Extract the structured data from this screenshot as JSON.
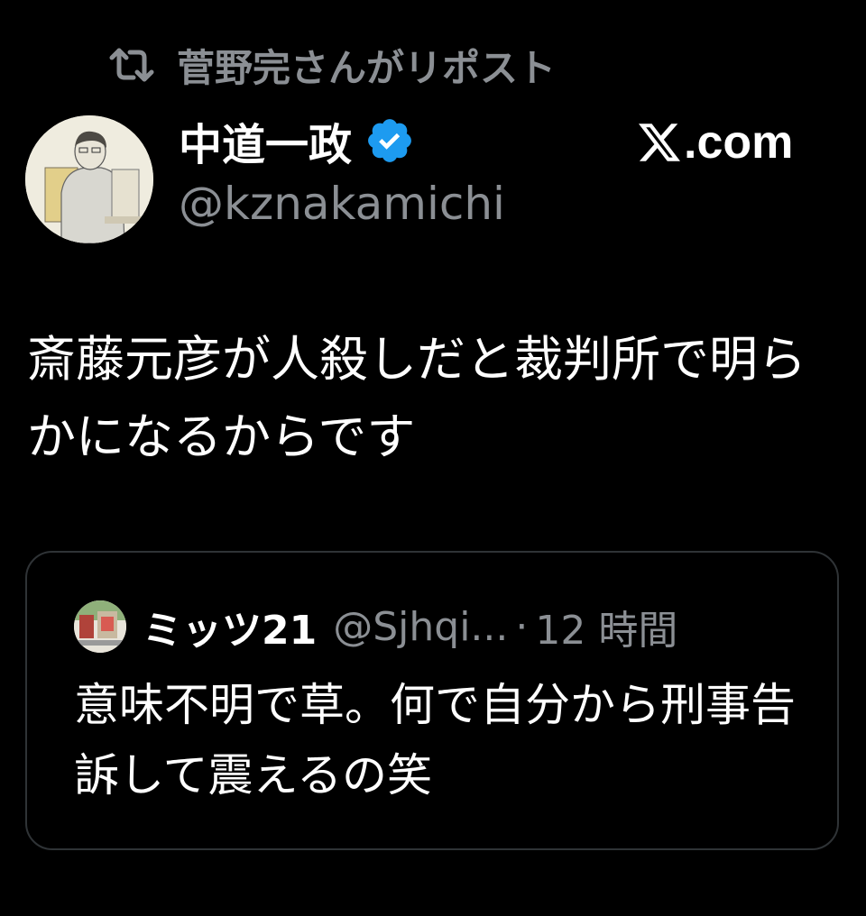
{
  "repost": {
    "icon": "repost-icon",
    "label": "菅野完さんがリポスト"
  },
  "author": {
    "display_name": "中道一政",
    "handle": "@kznakamichi",
    "verified": true,
    "verified_color": "#1d9bf0"
  },
  "source": {
    "label": ".com",
    "icon": "x-logo-icon"
  },
  "tweet": {
    "text": "斎藤元彦が人殺しだと裁判所で明らかになるからです"
  },
  "quote": {
    "display_name": "ミッツ21",
    "handle": "@Sjhqi...",
    "separator": "·",
    "time": "12 時間",
    "text": "意味不明で草。何で自分から刑事告訴して震えるの笑"
  },
  "colors": {
    "background": "#000000",
    "text_primary": "#ffffff",
    "text_secondary": "#8b8f94",
    "border": "#2f3336"
  }
}
